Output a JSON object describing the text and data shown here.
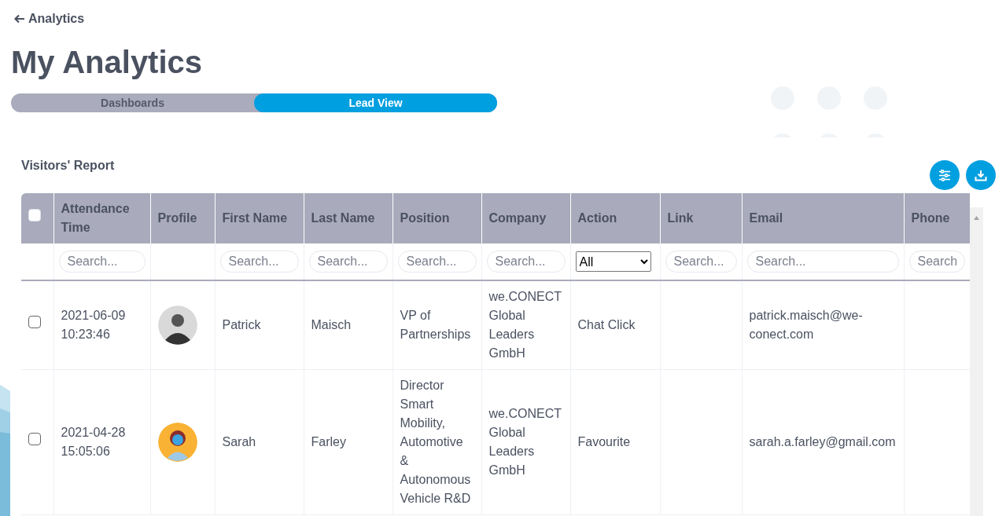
{
  "back_link": {
    "label": "Analytics"
  },
  "title": "My Analytics",
  "tabs": [
    {
      "label": "Dashboards",
      "selected": false
    },
    {
      "label": "Lead View",
      "selected": true
    }
  ],
  "report": {
    "title": "Visitors' Report",
    "actions": [
      {
        "kind": "filter"
      },
      {
        "kind": "download"
      }
    ]
  },
  "table": {
    "select_all": {
      "checked": false
    },
    "columns": [
      {
        "label": "Attendance Time",
        "filter": {
          "kind": "search",
          "placeholder": "Search..."
        }
      },
      {
        "label": "Profile",
        "filter": {
          "kind": "none"
        }
      },
      {
        "label": "First Name",
        "filter": {
          "kind": "search",
          "placeholder": "Search..."
        }
      },
      {
        "label": "Last Name",
        "filter": {
          "kind": "search",
          "placeholder": "Search..."
        }
      },
      {
        "label": "Position",
        "filter": {
          "kind": "search",
          "placeholder": "Search..."
        }
      },
      {
        "label": "Company",
        "filter": {
          "kind": "search",
          "placeholder": "Search..."
        }
      },
      {
        "label": "Action",
        "filter": {
          "kind": "select",
          "value": "All"
        }
      },
      {
        "label": "Link",
        "filter": {
          "kind": "search",
          "placeholder": "Search..."
        }
      },
      {
        "label": "Email",
        "filter": {
          "kind": "search",
          "placeholder": "Search..."
        }
      },
      {
        "label": "Phone",
        "filter": {
          "kind": "search",
          "placeholder": "Search"
        }
      }
    ],
    "rows": [
      {
        "checked": false,
        "avatar": {
          "kind": "photo"
        },
        "cells": [
          "2021-06-09 10:23:46",
          "",
          "Patrick",
          "Maisch",
          "VP of Partnerships",
          "we.CONECT Global Leaders GmbH",
          "Chat Click",
          "",
          "patrick.maisch@we-conect.com",
          ""
        ]
      },
      {
        "checked": false,
        "avatar": {
          "kind": "illustration"
        },
        "cells": [
          "2021-04-28 15:05:06",
          "",
          "Sarah",
          "Farley",
          "Director Smart Mobility, Automotive & Autonomous Vehicle R&D",
          "we.CONECT Global Leaders GmbH",
          "Favourite",
          "",
          "sarah.a.farley@gmail.com",
          ""
        ]
      }
    ]
  }
}
